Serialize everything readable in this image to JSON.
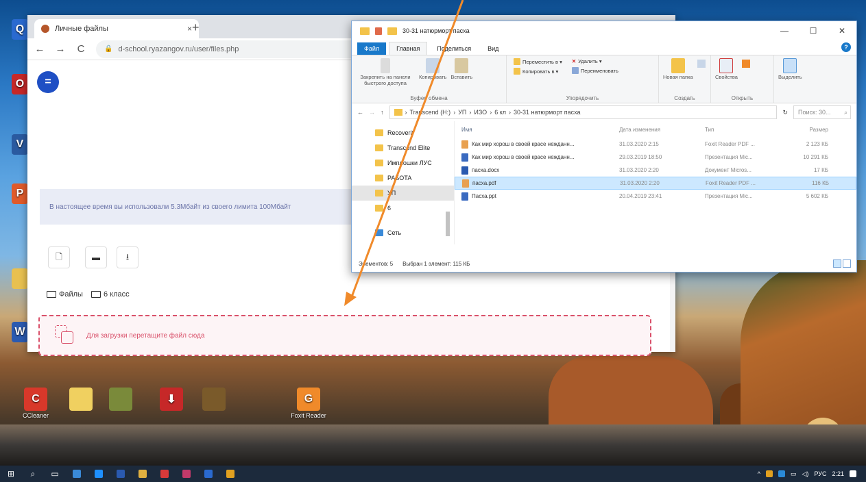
{
  "desktop": {
    "icons": [
      {
        "label": "CCleaner",
        "color": "#d8382a",
        "glyph": "C"
      },
      {
        "label": "",
        "color": "#f0d060",
        "glyph": ""
      },
      {
        "label": "",
        "color": "#7a8a3a",
        "glyph": ""
      },
      {
        "label": "",
        "color": "#c62828",
        "glyph": "⬇"
      },
      {
        "label": "",
        "color": "#7a5a2a",
        "glyph": ""
      },
      {
        "label": "Foxit Reader",
        "color": "#f08a2a",
        "glyph": "G"
      }
    ],
    "left_icons": [
      {
        "color": "#2a6ad0",
        "glyph": "Q"
      },
      {
        "color": "#c62828",
        "glyph": "O"
      },
      {
        "color": "#2a5aa0",
        "glyph": "V"
      },
      {
        "color": "#e05a2a",
        "glyph": "P"
      },
      {
        "color": "#e8c050",
        "glyph": ""
      },
      {
        "color": "#2a5ab0",
        "glyph": "W"
      }
    ]
  },
  "browser": {
    "tab_title": "Личные файлы",
    "tab_close": "×",
    "new_tab": "+",
    "nav_back": "←",
    "nav_forward": "→",
    "nav_reload": "C",
    "url": "d-school.ryazangov.ru/user/files.php",
    "menu_glyph": "=",
    "quota_text": "В настоящее время вы использовали 5.3Мбайт из своего лимита 100Мбайт",
    "tool_glyphs": [
      "🗋",
      "▬",
      "⭳"
    ],
    "breadcrumb": [
      "Файлы",
      "6 класс"
    ],
    "dropzone_text": "Для загрузки перетащите файл сюда"
  },
  "explorer": {
    "title": "30-31 натюрморт пасха",
    "ctrl_min": "—",
    "ctrl_max": "☐",
    "ctrl_close": "✕",
    "ribbon_tabs": [
      "Файл",
      "Главная",
      "Поделиться",
      "Вид"
    ],
    "help": "?",
    "groups": {
      "clipboard": "Буфер обмена",
      "organize": "Упорядочить",
      "create": "Создать",
      "open": "Открыть"
    },
    "buttons": {
      "pin": "Закрепить на панели быстрого доступа",
      "copy": "Копировать",
      "paste": "Вставить",
      "move_to": "Переместить в ▾",
      "copy_to": "Копировать в ▾",
      "delete": "Удалить ▾",
      "rename": "Переименовать",
      "new_folder": "Новая папка",
      "properties": "Свойства",
      "select": "Выделить"
    },
    "path": [
      "Transcend (H:)",
      "УП",
      "ИЗО",
      "6 кл",
      "30-31 натюрморт пасха"
    ],
    "search_placeholder": "Поиск: 30...",
    "nav_items": [
      "Recoverit",
      "Transcend Elite",
      "Имплошки ЛУС",
      "РАБОТА",
      "УП",
      "6",
      "Сеть"
    ],
    "columns": [
      "Имя",
      "Дата изменения",
      "Тип",
      "Размер"
    ],
    "files": [
      {
        "name": "Как мир хорош в своей красе нежданн...",
        "date": "31.03.2020 2:15",
        "type": "Foxit Reader PDF ...",
        "size": "2 123 КБ",
        "color": "#e8a050"
      },
      {
        "name": "Как мир хорош в своей красе нежданн...",
        "date": "29.03.2019 18:50",
        "type": "Презентация Mic...",
        "size": "10 291 КБ",
        "color": "#3a6ac0"
      },
      {
        "name": "пасха.docx",
        "date": "31.03.2020 2:20",
        "type": "Документ Micros...",
        "size": "17 КБ",
        "color": "#2a5ab0"
      },
      {
        "name": "пасха.pdf",
        "date": "31.03.2020 2:20",
        "type": "Foxit Reader PDF ...",
        "size": "116 КБ",
        "color": "#e8a050"
      },
      {
        "name": "Пасха.ppt",
        "date": "20.04.2019 23:41",
        "type": "Презентация Mic...",
        "size": "5 602 КБ",
        "color": "#3a6ac0"
      }
    ],
    "selected_index": 3,
    "status_count": "Элементов: 5",
    "status_selected": "Выбран 1 элемент: 115 КБ"
  },
  "taskbar": {
    "start": "⊞",
    "search": "⌕",
    "tray_lang": "РУС",
    "tray_time": "2:21",
    "apps": [
      "#3a8ad8",
      "#1e90ff",
      "#2a5ab0",
      "#e0b040",
      "#d83a3a",
      "#c23a6a",
      "#2a6ad0",
      "#e0a020"
    ]
  },
  "colors": {
    "arrow": "#f08a2a",
    "dropzone": "#d9506a",
    "accent": "#1979ca"
  }
}
